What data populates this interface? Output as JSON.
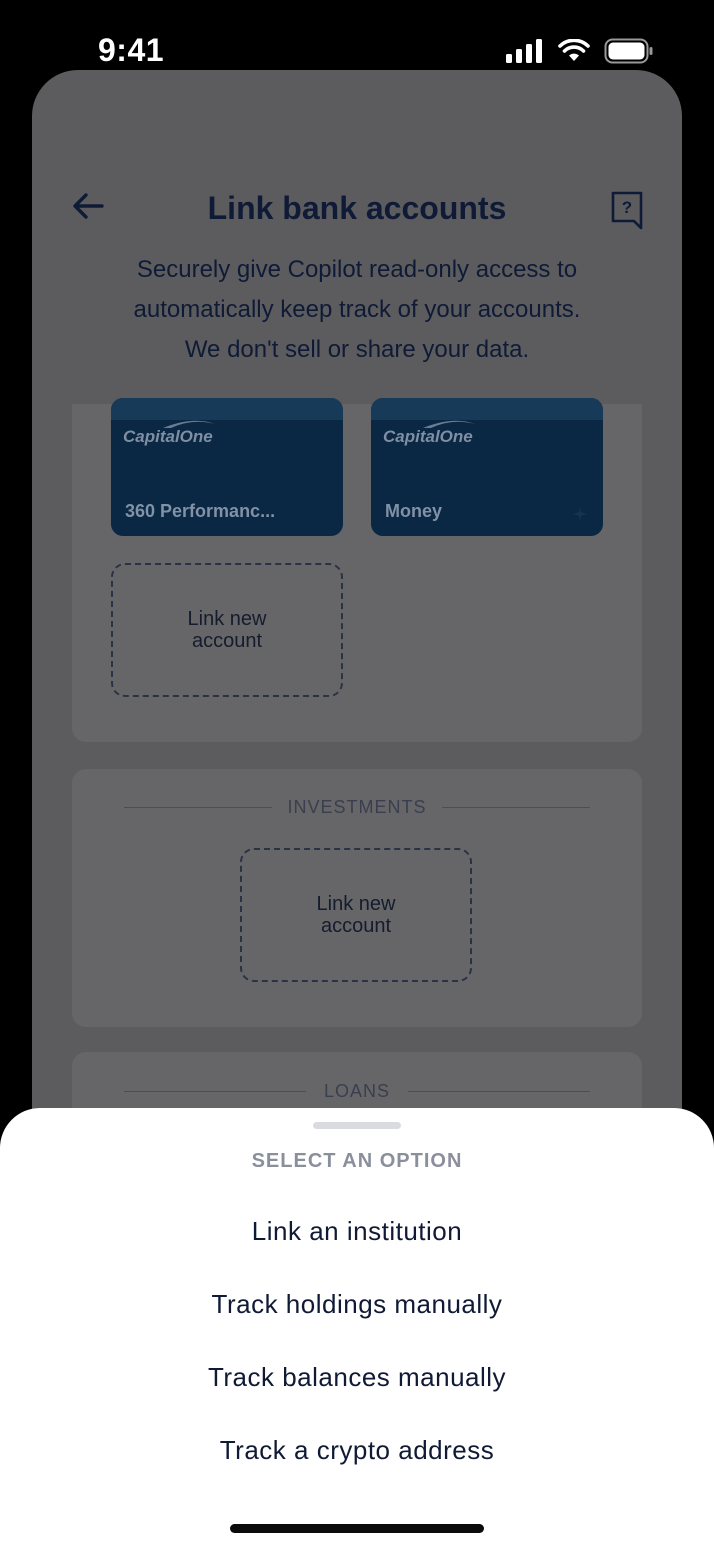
{
  "status_bar": {
    "time": "9:41"
  },
  "header": {
    "title": "Link bank accounts"
  },
  "subtitle": {
    "line1": "Securely give Copilot read-only access to",
    "line2": "automatically keep track of your accounts.",
    "line3": "We don't sell or share your data."
  },
  "cards": [
    {
      "bank": "CapitalOne",
      "name": "360 Performanc..."
    },
    {
      "bank": "CapitalOne",
      "name": "Money"
    }
  ],
  "link_tile": {
    "line1": "Link new",
    "line2": "account"
  },
  "sections": {
    "investments": "INVESTMENTS",
    "loans": "LOANS"
  },
  "sheet": {
    "title": "SELECT AN OPTION",
    "options": [
      "Link an institution",
      "Track holdings manually",
      "Track balances manually",
      "Track a crypto address"
    ]
  },
  "colors": {
    "accent": "#0f1b36",
    "card": "#0a2743",
    "overlay": "#5c5c5e"
  }
}
